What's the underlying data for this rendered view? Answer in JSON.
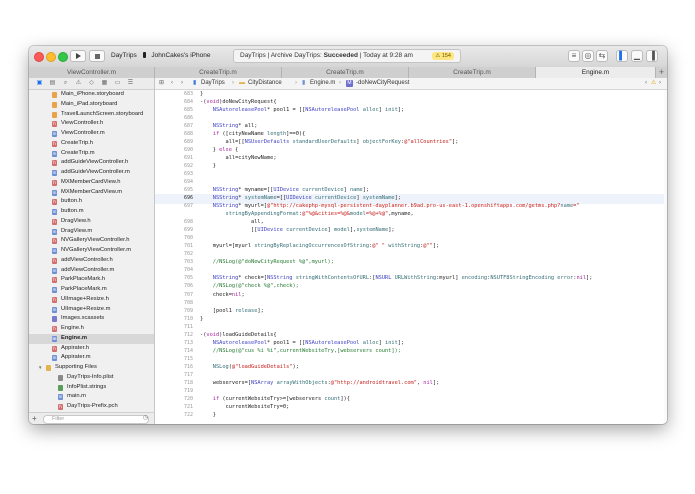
{
  "toolbar": {
    "run_icon": "run-icon",
    "stop_icon": "stop-icon",
    "scheme": "DayTrips",
    "destination": "JohnCakes's iPhone",
    "activity_project": "DayTrips",
    "activity_text": "Archive DayTrips:",
    "activity_status": "Succeeded",
    "activity_time": "Today at 9:28 am",
    "warning_count": "154"
  },
  "tabs": [
    {
      "label": "ViewController.m"
    },
    {
      "label": "CreateTrip.m"
    },
    {
      "label": "CreateTrip.m"
    },
    {
      "label": "CreateTrip.m"
    },
    {
      "label": "Engine.m"
    }
  ],
  "tab_add": "+",
  "sidebar": {
    "files": [
      {
        "name": "Main_iPhone.storyboard",
        "type": "sb",
        "glyph": "",
        "indent": 32
      },
      {
        "name": "Main_iPad.storyboard",
        "type": "sb",
        "glyph": "",
        "indent": 32
      },
      {
        "name": "TravelLaunchScreen.storyboard",
        "type": "sb",
        "glyph": "",
        "indent": 32
      },
      {
        "name": "ViewController.h",
        "type": "h",
        "glyph": "h",
        "indent": 32
      },
      {
        "name": "ViewController.m",
        "type": "m",
        "glyph": "m",
        "indent": 32
      },
      {
        "name": "CreateTrip.h",
        "type": "h",
        "glyph": "h",
        "indent": 32
      },
      {
        "name": "CreateTrip.m",
        "type": "m",
        "glyph": "m",
        "indent": 32
      },
      {
        "name": "addGuideViewController.h",
        "type": "h",
        "glyph": "h",
        "indent": 32
      },
      {
        "name": "addGuideViewController.m",
        "type": "m",
        "glyph": "m",
        "indent": 32
      },
      {
        "name": "MXMemberCardView.h",
        "type": "h",
        "glyph": "h",
        "indent": 32
      },
      {
        "name": "MXMemberCardView.m",
        "type": "m",
        "glyph": "m",
        "indent": 32
      },
      {
        "name": "button.h",
        "type": "h",
        "glyph": "h",
        "indent": 32
      },
      {
        "name": "button.m",
        "type": "m",
        "glyph": "m",
        "indent": 32
      },
      {
        "name": "DragView.h",
        "type": "h",
        "glyph": "h",
        "indent": 32
      },
      {
        "name": "DragView.m",
        "type": "m",
        "glyph": "m",
        "indent": 32
      },
      {
        "name": "NVGalleryViewController.h",
        "type": "h",
        "glyph": "h",
        "indent": 32
      },
      {
        "name": "NVGalleryViewController.m",
        "type": "m",
        "glyph": "m",
        "indent": 32
      },
      {
        "name": "addViewController.h",
        "type": "h",
        "glyph": "h",
        "indent": 32
      },
      {
        "name": "addViewController.m",
        "type": "m",
        "glyph": "m",
        "indent": 32
      },
      {
        "name": "ParkPlaceMark.h",
        "type": "h",
        "glyph": "h",
        "indent": 32
      },
      {
        "name": "ParkPlaceMark.m",
        "type": "m",
        "glyph": "m",
        "indent": 32
      },
      {
        "name": "UIImage+Resize.h",
        "type": "h",
        "glyph": "h",
        "indent": 32
      },
      {
        "name": "UIImage+Resize.m",
        "type": "m",
        "glyph": "m",
        "indent": 32
      },
      {
        "name": "Images.xcassets",
        "type": "as",
        "glyph": "",
        "indent": 32
      },
      {
        "name": "Engine.h",
        "type": "h",
        "glyph": "h",
        "indent": 32
      },
      {
        "name": "Engine.m",
        "type": "m",
        "glyph": "m",
        "indent": 32,
        "selected": true
      },
      {
        "name": "Appirater.h",
        "type": "h",
        "glyph": "h",
        "indent": 32
      },
      {
        "name": "Appirater.m",
        "type": "m",
        "glyph": "m",
        "indent": 32
      },
      {
        "name": "Supporting Files",
        "type": "fd",
        "glyph": "",
        "indent": 26
      },
      {
        "name": "DayTrips-Info.plist",
        "type": "pl",
        "glyph": "",
        "indent": 38
      },
      {
        "name": "InfoPlist.strings",
        "type": "st",
        "glyph": "",
        "indent": 38
      },
      {
        "name": "main.m",
        "type": "m",
        "glyph": "m",
        "indent": 38
      },
      {
        "name": "DayTrips-Prefix.pch",
        "type": "h",
        "glyph": "h",
        "indent": 38
      }
    ],
    "filter_placeholder": "Filter"
  },
  "jumpbar": {
    "project": "DayTrips",
    "group": "CityDistance",
    "file": "Engine.m",
    "symbol_badge": "M",
    "symbol": "-doNewCityRequest"
  },
  "code": [
    {
      "n": "683",
      "t": "}"
    },
    {
      "n": "684",
      "t": "-(void)doNewCityRequest{"
    },
    {
      "n": "685",
      "t": "    NSAutoreleasePool* pool1 = [[NSAutoreleasePool alloc] init];"
    },
    {
      "n": "686",
      "t": ""
    },
    {
      "n": "687",
      "t": "    NSString* all;"
    },
    {
      "n": "688",
      "t": "    if ([cityNewName length]==0){"
    },
    {
      "n": "689",
      "t": "        all=[[NSUserDefaults standardUserDefaults] objectForKey:@\"allCountries\"];"
    },
    {
      "n": "690",
      "t": "    } else {"
    },
    {
      "n": "691",
      "t": "        all=cityNewName;"
    },
    {
      "n": "692",
      "t": "    }"
    },
    {
      "n": "693",
      "t": ""
    },
    {
      "n": "694",
      "t": ""
    },
    {
      "n": "695",
      "t": "    NSString* myname=[[UIDevice currentDevice] name];"
    },
    {
      "n": "696",
      "t": "    NSString* systemName=[[UIDevice currentDevice] systemName];",
      "cur": true
    },
    {
      "n": "697",
      "t": "    NSString* myurl=[@\"http://cakephp-mysql-persistent-dayplanner.b9ad.pro-us-east-1.openshiftapps.com/getms.php?name=\""
    },
    {
      "n": "",
      "t": "        stringByAppendingFormat:@\"%@&cities=%@&model=%@+%@\",myname,"
    },
    {
      "n": "698",
      "t": "                all,"
    },
    {
      "n": "699",
      "t": "                [[UIDevice currentDevice] model],systemName];"
    },
    {
      "n": "700",
      "t": ""
    },
    {
      "n": "701",
      "t": "    myurl=[myurl stringByReplacingOccurrencesOfString:@\" \" withString:@\"\"];"
    },
    {
      "n": "702",
      "t": ""
    },
    {
      "n": "703",
      "t": "    //NSLog(@\"doNewCityRequest %@\",myurl);"
    },
    {
      "n": "704",
      "t": ""
    },
    {
      "n": "705",
      "t": "    NSString* check=[NSString stringWithContentsOfURL:[NSURL URLWithString:myurl] encoding:NSUTF8StringEncoding error:nil];"
    },
    {
      "n": "706",
      "t": "    //NSLog(@\"check %@\",check);"
    },
    {
      "n": "707",
      "t": "    check=nil;"
    },
    {
      "n": "708",
      "t": ""
    },
    {
      "n": "709",
      "t": "    [pool1 release];"
    },
    {
      "n": "710",
      "t": "}"
    },
    {
      "n": "711",
      "t": ""
    },
    {
      "n": "712",
      "t": "-(void)loadGuideDetails{"
    },
    {
      "n": "713",
      "t": "    NSAutoreleasePool* pool1 = [[NSAutoreleasePool alloc] init];"
    },
    {
      "n": "714",
      "t": "    //NSLog(@\"cus %i %i\",currentWebsiteTry,[webservers count]);"
    },
    {
      "n": "715",
      "t": ""
    },
    {
      "n": "716",
      "t": "    NSLog(@\"loadGuideDetails\");"
    },
    {
      "n": "717",
      "t": ""
    },
    {
      "n": "718",
      "t": "    webservers=[NSArray arrayWithObjects:@\"http://androidtravel.com\", nil];"
    },
    {
      "n": "719",
      "t": ""
    },
    {
      "n": "720",
      "t": "    if (currentWebsiteTry>=[webservers count]){"
    },
    {
      "n": "721",
      "t": "        currentWebsiteTry=0;"
    },
    {
      "n": "722",
      "t": "    }"
    }
  ]
}
